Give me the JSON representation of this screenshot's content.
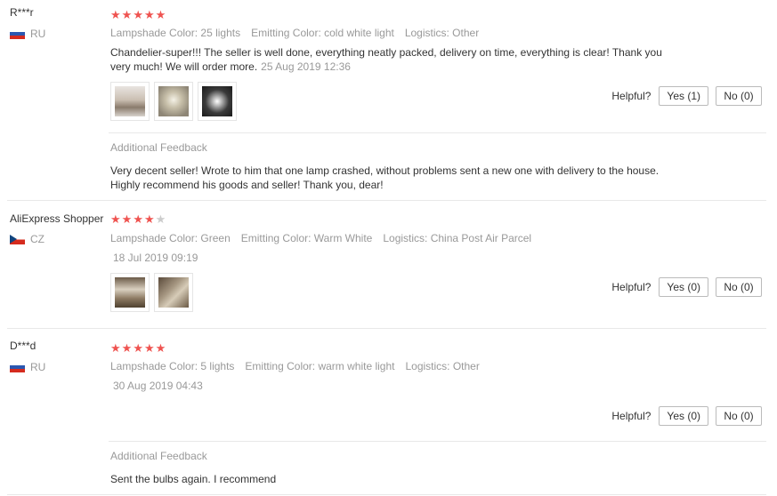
{
  "helpful_label": "Helpful?",
  "feedback_title": "Additional Feedback",
  "reviews": [
    {
      "user": "R***r",
      "country": "RU",
      "rating": 5,
      "props": [
        "Lampshade Color: 25 lights",
        "Emitting Color: cold white light",
        "Logistics: Other"
      ],
      "text": "Chandelier-super!!! The seller is well done, everything neatly packed, delivery on time, everything is clear! Thank you very much! We will order more.",
      "date": "25 Aug 2019 12:36",
      "yes": "Yes (1)",
      "no": "No (0)",
      "additional_feedback": "Very decent seller! Wrote to him that one lamp crashed, without problems sent a new one with delivery to the house. Highly recommend his goods and seller! Thank you, dear!"
    },
    {
      "user": "AliExpress Shopper",
      "country": "CZ",
      "rating": 4,
      "props": [
        "Lampshade Color: Green",
        "Emitting Color: Warm White",
        "Logistics: China Post Air Parcel"
      ],
      "date": "18 Jul 2019 09:19",
      "yes": "Yes (0)",
      "no": "No (0)"
    },
    {
      "user": "D***d",
      "country": "RU",
      "rating": 5,
      "props": [
        "Lampshade Color: 5 lights",
        "Emitting Color: warm white light",
        "Logistics: Other"
      ],
      "date": "30 Aug 2019 04:43",
      "yes": "Yes (0)",
      "no": "No (0)",
      "additional_feedback": "Sent the bulbs again. I recommend"
    }
  ],
  "colors": {
    "star": "#ef5350",
    "muted": "#999999"
  }
}
